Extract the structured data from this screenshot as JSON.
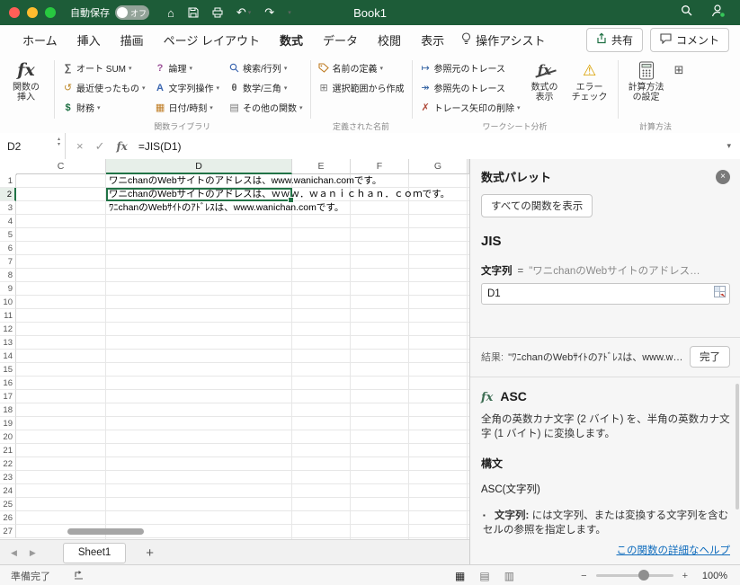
{
  "colors": {
    "titlebar_green": "#1d5c38",
    "excel_green": "#217346",
    "selection_green": "#217346",
    "link_blue": "#0f6cbd",
    "warning_yellow": "#d9a000"
  },
  "titlebar": {
    "autosave_label": "自動保存",
    "autosave_state": "オフ",
    "document_title": "Book1"
  },
  "ribbon": {
    "tabs": [
      {
        "name": "home",
        "label": "ホーム"
      },
      {
        "name": "insert",
        "label": "挿入"
      },
      {
        "name": "draw",
        "label": "描画"
      },
      {
        "name": "page-layout",
        "label": "ページ レイアウト"
      },
      {
        "name": "formulas",
        "label": "数式",
        "active": true
      },
      {
        "name": "data",
        "label": "データ"
      },
      {
        "name": "review",
        "label": "校閲"
      },
      {
        "name": "view",
        "label": "表示"
      }
    ],
    "assist_label": "操作アシスト",
    "share_label": "共有",
    "comments_label": "コメント",
    "insert_function": {
      "line1": "関数の",
      "line2": "挿入"
    },
    "function_library": {
      "group_label": "関数ライブラリ",
      "items": [
        {
          "name": "autosum",
          "icon": "autosum",
          "label": "オート SUM",
          "chevron": true
        },
        {
          "name": "recently-used",
          "icon": "recent",
          "label": "最近使ったもの",
          "chevron": true
        },
        {
          "name": "financial",
          "icon": "financial",
          "label": "財務",
          "chevron": true
        },
        {
          "name": "logical",
          "icon": "logical",
          "label": "論理",
          "chevron": true
        },
        {
          "name": "text",
          "icon": "text",
          "label": "文字列操作",
          "chevron": true
        },
        {
          "name": "date-time",
          "icon": "datetime",
          "label": "日付/時刻",
          "chevron": true
        },
        {
          "name": "lookup-reference",
          "icon": "lookup",
          "label": "検索/行列",
          "chevron": true
        },
        {
          "name": "math-trig",
          "icon": "math",
          "label": "数学/三角",
          "chevron": true
        },
        {
          "name": "more-functions",
          "icon": "more",
          "label": "その他の関数",
          "chevron": true
        }
      ]
    },
    "defined_names": {
      "group_label": "定義された名前",
      "items": [
        {
          "name": "define-name",
          "icon": "tag",
          "label": "名前の定義",
          "chevron": true
        },
        {
          "name": "create-from-selection",
          "icon": "create-names",
          "label": "選択範囲から作成",
          "chevron": false
        }
      ]
    },
    "worksheet_analysis": {
      "group_label": "ワークシート分析",
      "items": [
        {
          "name": "trace-precedents",
          "icon": "trace-precedents",
          "label": "参照元のトレース",
          "chevron": false
        },
        {
          "name": "trace-dependents",
          "icon": "trace-dependents",
          "label": "参照先のトレース",
          "chevron": false
        },
        {
          "name": "remove-arrows",
          "icon": "remove-arrows",
          "label": "トレース矢印の削除",
          "chevron": true
        }
      ],
      "big_items": [
        {
          "name": "show-formulas",
          "icon": "show-formulas",
          "line1": "数式の",
          "line2": "表示"
        },
        {
          "name": "error-checking",
          "icon": "error-check",
          "line1": "エラー",
          "line2": "チェック"
        }
      ]
    },
    "calculation": {
      "group_label": "計算方法",
      "big_item": {
        "line1": "計算方法",
        "line2": "の設定"
      }
    }
  },
  "formula_bar": {
    "name_box": "D2",
    "formula": "=JIS(D1)"
  },
  "grid": {
    "column_headers": [
      "C",
      "D",
      "E",
      "F",
      "G"
    ],
    "selected_column": "D",
    "selected_row": 2,
    "selected_cell": "D2",
    "row_count": 27,
    "cells": {
      "D1": "ワニchanのWebサイトのアドレスは、www.wanichan.comです。",
      "D2": "ワニchanのWebサイトのアドレスは、ｗｗｗ．ｗａｎｉｃｈａｎ．ｃｏｍです。",
      "D3": "ﾜﾆchanのWebｻｲﾄのｱﾄﾞﾚｽは、www.wanichan.comです。"
    }
  },
  "panel": {
    "title": "数式パレット",
    "show_all_button": "すべての関数を表示",
    "function_name": "JIS",
    "argument": {
      "label": "文字列",
      "equals": "=",
      "preview": "\"ワニchanのWebサイトのアドレス…",
      "value": "D1"
    },
    "result_label": "結果:",
    "result_value": "\"ﾜﾆchanのWebｻｲﾄのｱﾄﾞﾚｽは、www.wan…",
    "done_button": "完了",
    "next_function": {
      "icon_label": "fx",
      "name": "ASC",
      "description": "全角の英数カナ文字 (2 バイト) を、半角の英数カナ文字 (1 バイト) に変換します。",
      "syntax_heading": "構文",
      "syntax": "ASC(文字列)",
      "argument_term": "文字列:",
      "argument_text": "には文字列、または変換する文字列を含むセルの参照を指定します。"
    },
    "help_link": "この関数の詳細なヘルプ"
  },
  "sheet_bar": {
    "active_tab": "Sheet1",
    "add_button": "+"
  },
  "status_bar": {
    "status": "準備完了",
    "zoom": "100%"
  }
}
